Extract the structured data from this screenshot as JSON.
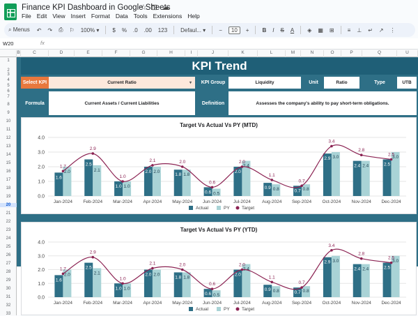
{
  "window": {
    "title": "Finance KPI Dashboard in Google Sheets",
    "menu": [
      "File",
      "Edit",
      "View",
      "Insert",
      "Format",
      "Data",
      "Tools",
      "Extensions",
      "Help"
    ]
  },
  "toolbar": {
    "menus_label": "Menus",
    "zoom": "100%",
    "currency": "$",
    "percent": "%",
    "dec_less": ".0",
    "dec_more": ".00",
    "num_format": "123",
    "font": "Defaul...",
    "font_size": "10",
    "bold": "B",
    "italic": "I",
    "strike": "S",
    "text_color": "A"
  },
  "formula_bar": {
    "cell_ref": "W20",
    "fx": "fx"
  },
  "columns": [
    "A",
    "B",
    "C",
    "D",
    "E",
    "F",
    "G",
    "H",
    "I",
    "J",
    "K",
    "L",
    "M",
    "N",
    "O",
    "P",
    "Q",
    "U"
  ],
  "rows": [
    "1",
    "2",
    "3",
    "4",
    "5",
    "6",
    "7",
    "8",
    "9",
    "10",
    "11",
    "12",
    "13",
    "14",
    "15",
    "16",
    "17",
    "18",
    "19",
    "20",
    "21",
    "22",
    "23",
    "24",
    "25",
    "26",
    "27",
    "28",
    "29",
    "30",
    "31",
    "32",
    "33",
    "34",
    "35",
    "36"
  ],
  "dashboard": {
    "header": "KPI Trend",
    "select_kpi_label": "Select KPI",
    "select_kpi_value": "Current Ratio",
    "kpi_group_label": "KPI Group",
    "kpi_group_value": "Liquidity",
    "unit_label": "Unit",
    "unit_value": "Ratio",
    "type_label": "Type",
    "type_value": "UTB",
    "formula_label": "Formula",
    "formula_value": "Current Assets / Current Liabilities",
    "definition_label": "Definition",
    "definition_value": "Assesses the company's ability to pay short-term obligations."
  },
  "colors": {
    "actual": "#2e6f86",
    "py": "#a9d3d6",
    "target": "#8b2252",
    "header_bg": "#1f5f77",
    "orange": "#e8783d"
  },
  "chart_data": [
    {
      "type": "bar",
      "title": "Target Vs Actual Vs PY (MTD)",
      "categories": [
        "Jan-2024",
        "Feb-2024",
        "Mar-2024",
        "Apr-2024",
        "May-2024",
        "Jun-2024",
        "Jul-2024",
        "Aug-2024",
        "Sep-2024",
        "Oct-2024",
        "Nov-2024",
        "Dec-2024"
      ],
      "ylim": [
        0,
        4
      ],
      "yticks": [
        "0.0",
        "1.0",
        "2.0",
        "3.0",
        "4.0"
      ],
      "grid": true,
      "legend_position": "bottom",
      "series": [
        {
          "name": "Actual",
          "type": "bar",
          "values": [
            1.6,
            2.5,
            1.0,
            2.0,
            1.8,
            0.6,
            2.0,
            0.9,
            0.7,
            2.9,
            2.4,
            2.5
          ]
        },
        {
          "name": "PY",
          "type": "bar",
          "values": [
            2.0,
            2.1,
            1.0,
            2.0,
            1.8,
            0.5,
            2.4,
            0.8,
            0.8,
            3.0,
            2.4,
            3.0
          ]
        },
        {
          "name": "Target",
          "type": "line",
          "values": [
            1.7,
            2.9,
            1.0,
            2.1,
            2.0,
            0.6,
            2.0,
            1.1,
            0.7,
            3.4,
            2.8,
            2.5
          ]
        }
      ]
    },
    {
      "type": "bar",
      "title": "Target Vs Actual Vs PY (YTD)",
      "categories": [
        "Jan-2024",
        "Feb-2024",
        "Mar-2024",
        "Apr-2024",
        "May-2024",
        "Jun-2024",
        "Jul-2024",
        "Aug-2024",
        "Sep-2024",
        "Oct-2024",
        "Nov-2024",
        "Dec-2024"
      ],
      "ylim": [
        0,
        4
      ],
      "yticks": [
        "0.0",
        "1.0",
        "2.0",
        "3.0",
        "4.0"
      ],
      "grid": true,
      "legend_position": "bottom",
      "series": [
        {
          "name": "Actual",
          "type": "bar",
          "values": [
            1.6,
            2.5,
            1.0,
            2.0,
            1.8,
            0.6,
            2.0,
            0.9,
            0.7,
            2.9,
            2.4,
            2.5
          ]
        },
        {
          "name": "PY",
          "type": "bar",
          "values": [
            2.0,
            2.1,
            1.0,
            2.0,
            1.8,
            0.5,
            2.4,
            0.8,
            0.8,
            3.0,
            2.4,
            3.0
          ]
        },
        {
          "name": "Target",
          "type": "line",
          "values": [
            1.7,
            2.9,
            1.0,
            2.1,
            2.0,
            0.6,
            2.0,
            1.1,
            0.7,
            3.4,
            2.8,
            2.5
          ]
        }
      ]
    }
  ]
}
